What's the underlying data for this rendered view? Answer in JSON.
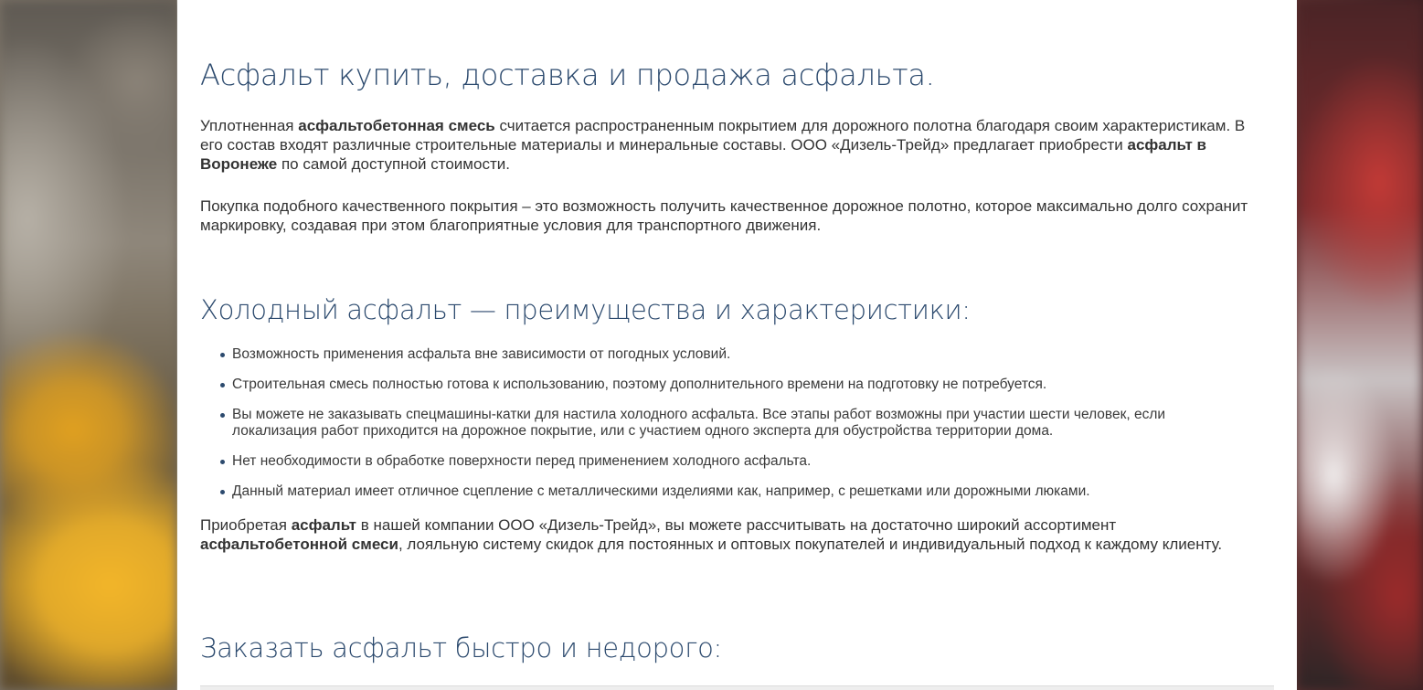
{
  "title": "Асфальт купить, доставка и продажа асфальта.",
  "intro": {
    "p1_a": "Уплотненная ",
    "p1_b": "асфальтобетонная смесь",
    "p1_c": " считается распространенным покрытием для дорожного полотна благодаря своим характеристикам. В его состав входят различные строительные материалы и минеральные составы. ООО «Дизель-Трейд» предлагает приобрести ",
    "p1_d": "асфальт в Воронеже",
    "p1_e": " по самой доступной стоимости.",
    "p2": "Покупка подобного качественного покрытия – это возможность получить качественное дорожное полотно, которое максимально долго сохранит маркировку, создавая при этом благоприятные условия для транспортного движения."
  },
  "cold": {
    "heading": "Холодный асфальт — преимущества и характеристики:",
    "items": [
      "Возможность применения асфальта вне зависимости от погодных условий.",
      "Строительная смесь полностью готова к использованию, поэтому дополнительного времени на подготовку не потребуется.",
      "Вы можете не заказывать спецмашины-катки для настила холодного асфальта. Все этапы работ возможны при участии шести человек, если локализация работ приходится на дорожное покрытие, или с участием одного эксперта для обустройства территории дома.",
      "Нет необходимости в обработке поверхности перед применением холодного асфальта.",
      "Данный материал имеет отличное сцепление с металлическими изделиями как, например, с решетками или дорожными люками."
    ]
  },
  "closing": {
    "a": "Приобретая ",
    "b": "асфальт",
    "c": " в нашей компании ООО «Дизель-Трейд», вы можете рассчитывать на достаточно широкий ассортимент ",
    "d": "асфальтобетонной смеси",
    "e": ", лояльную систему скидок для постоянных и оптовых покупателей и индивидуальный подход к каждому клиенту."
  },
  "order": {
    "heading": "Заказать асфальт быстро и недорого:"
  },
  "colors": {
    "heading": "#2c4a6e",
    "text": "#333333",
    "panel": "#ffffff"
  }
}
